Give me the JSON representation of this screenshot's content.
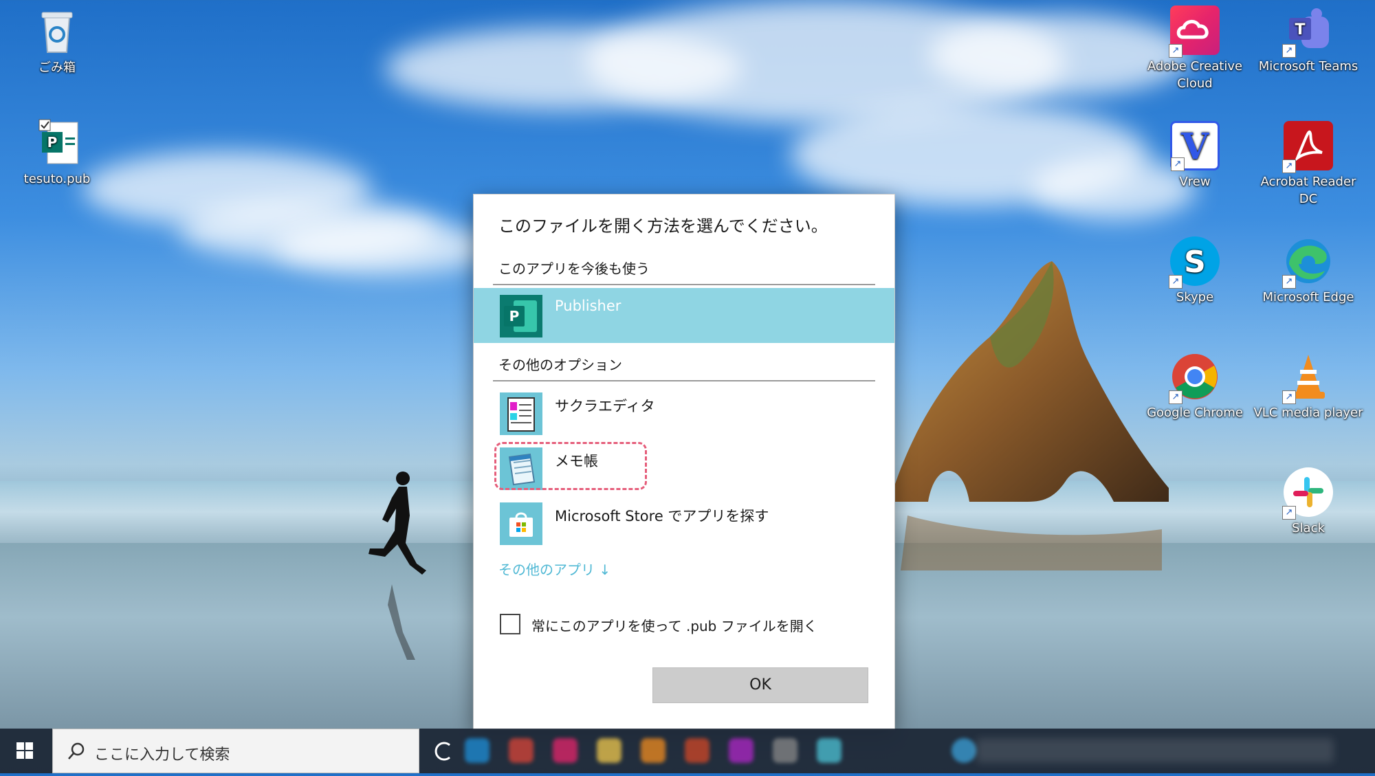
{
  "desktop": {
    "left_icons": [
      {
        "label": "ごみ箱"
      },
      {
        "label": "tesuto.pub"
      }
    ],
    "right_icons": [
      {
        "label": "Adobe Creative Cloud"
      },
      {
        "label": "Microsoft Teams"
      },
      {
        "label": "Vrew"
      },
      {
        "label": "Acrobat Reader DC"
      },
      {
        "label": "Skype"
      },
      {
        "label": "Microsoft Edge"
      },
      {
        "label": "Google Chrome"
      },
      {
        "label": "VLC media player"
      },
      {
        "label": "Slack"
      }
    ]
  },
  "dialog": {
    "title": "このファイルを開く方法を選んでください。",
    "keep_using_label": "このアプリを今後も使う",
    "primary_app": {
      "name": "Publisher"
    },
    "other_options_label": "その他のオプション",
    "other_apps": [
      {
        "name": "サクラエディタ"
      },
      {
        "name": "メモ帳"
      },
      {
        "name": "Microsoft Store でアプリを探す"
      }
    ],
    "more_apps_link": "その他のアプリ ↓",
    "always_use_label": "常にこのアプリを使って .pub ファイルを開く",
    "always_use_checked": false,
    "ok_label": "OK"
  },
  "taskbar": {
    "search_placeholder": "ここに入力して検索"
  },
  "colors": {
    "selected_row": "#8fd5e3",
    "link": "#4fb8d4",
    "highlight_dashed": "#e55d7a"
  }
}
